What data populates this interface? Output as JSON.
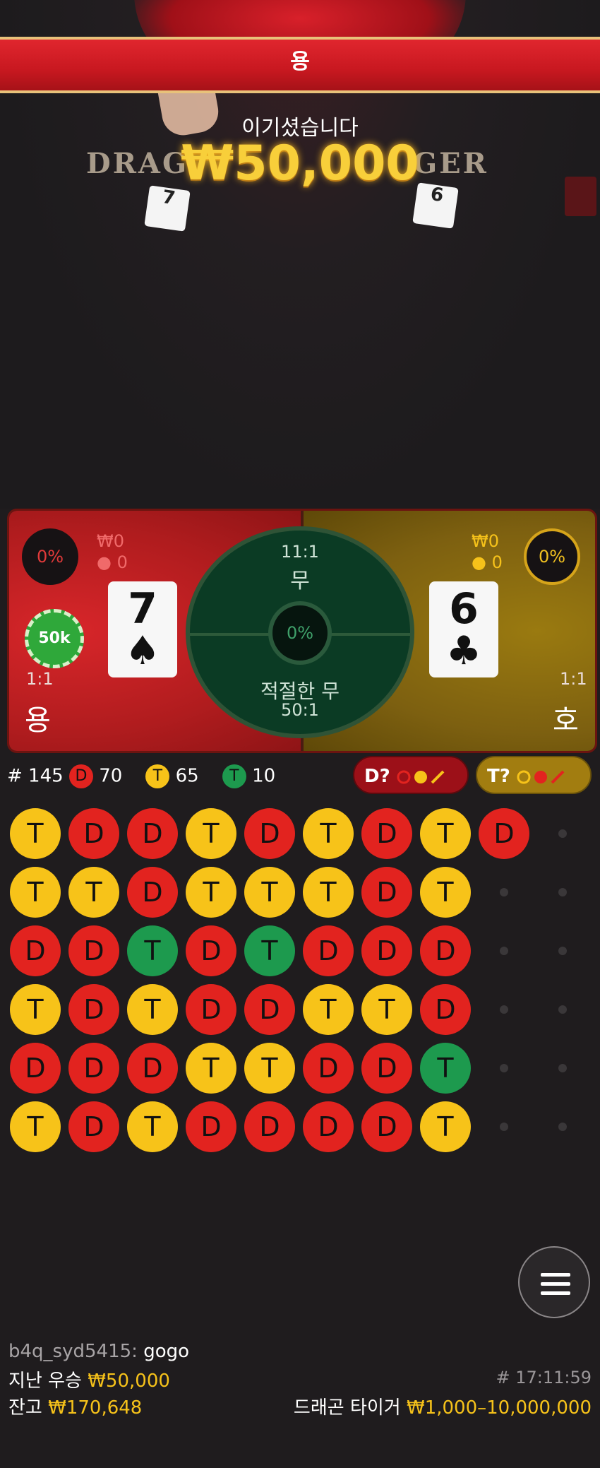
{
  "banner": {
    "label": "용"
  },
  "result": {
    "win_label": "이기셨습니다",
    "win_amount": "₩50,000",
    "logo_left": "DRAG",
    "logo_right": "GER"
  },
  "table_cards": {
    "left": "7",
    "right": "6"
  },
  "dragon": {
    "name": "용",
    "percent": "0%",
    "amount": "₩0",
    "players": "0",
    "odds": "1:1",
    "chip": "50k",
    "card": {
      "rank": "7",
      "suit": "♠"
    }
  },
  "tiger": {
    "name": "호",
    "percent": "0%",
    "amount": "₩0",
    "players": "0",
    "odds": "1:1",
    "card": {
      "rank": "6",
      "suit": "♣"
    }
  },
  "tie": {
    "odds": "11:1",
    "label": "무",
    "percent": "0%",
    "suited_label": "적절한 무",
    "suited_odds": "50:1"
  },
  "stats": {
    "round": "# 145",
    "dragon_letter": "D",
    "dragon_count": "70",
    "tiger_letter": "T",
    "tiger_count": "65",
    "tie_letter": "T",
    "tie_count": "10"
  },
  "predict": {
    "dragon": "D?",
    "tiger": "T?"
  },
  "road": {
    "rows": [
      [
        "T",
        "D",
        "D",
        "T",
        "D",
        "T",
        "D",
        "T",
        "D"
      ],
      [
        "T",
        "T",
        "D",
        "T",
        "T",
        "T",
        "D",
        "T"
      ],
      [
        "D",
        "D",
        "G",
        "D",
        "G",
        "D",
        "D",
        "D"
      ],
      [
        "T",
        "D",
        "T",
        "D",
        "D",
        "T",
        "T",
        "D"
      ],
      [
        "D",
        "D",
        "D",
        "T",
        "T",
        "D",
        "D",
        "G"
      ],
      [
        "T",
        "D",
        "T",
        "D",
        "D",
        "D",
        "D",
        "T"
      ]
    ],
    "colors": {
      "D": "#e2231f",
      "T": "#f7c319",
      "G": "#1d9a4e"
    }
  },
  "chat": {
    "user": "b4q_syd5415:",
    "message": "gogo"
  },
  "footer": {
    "last_win_label": "지난 우승",
    "last_win_value": "₩50,000",
    "balance_label": "잔고",
    "balance_value": "₩170,648",
    "time": "# 17:11:59",
    "game_label": "드래곤 타이거",
    "limits": "₩1,000–10,000,000"
  }
}
